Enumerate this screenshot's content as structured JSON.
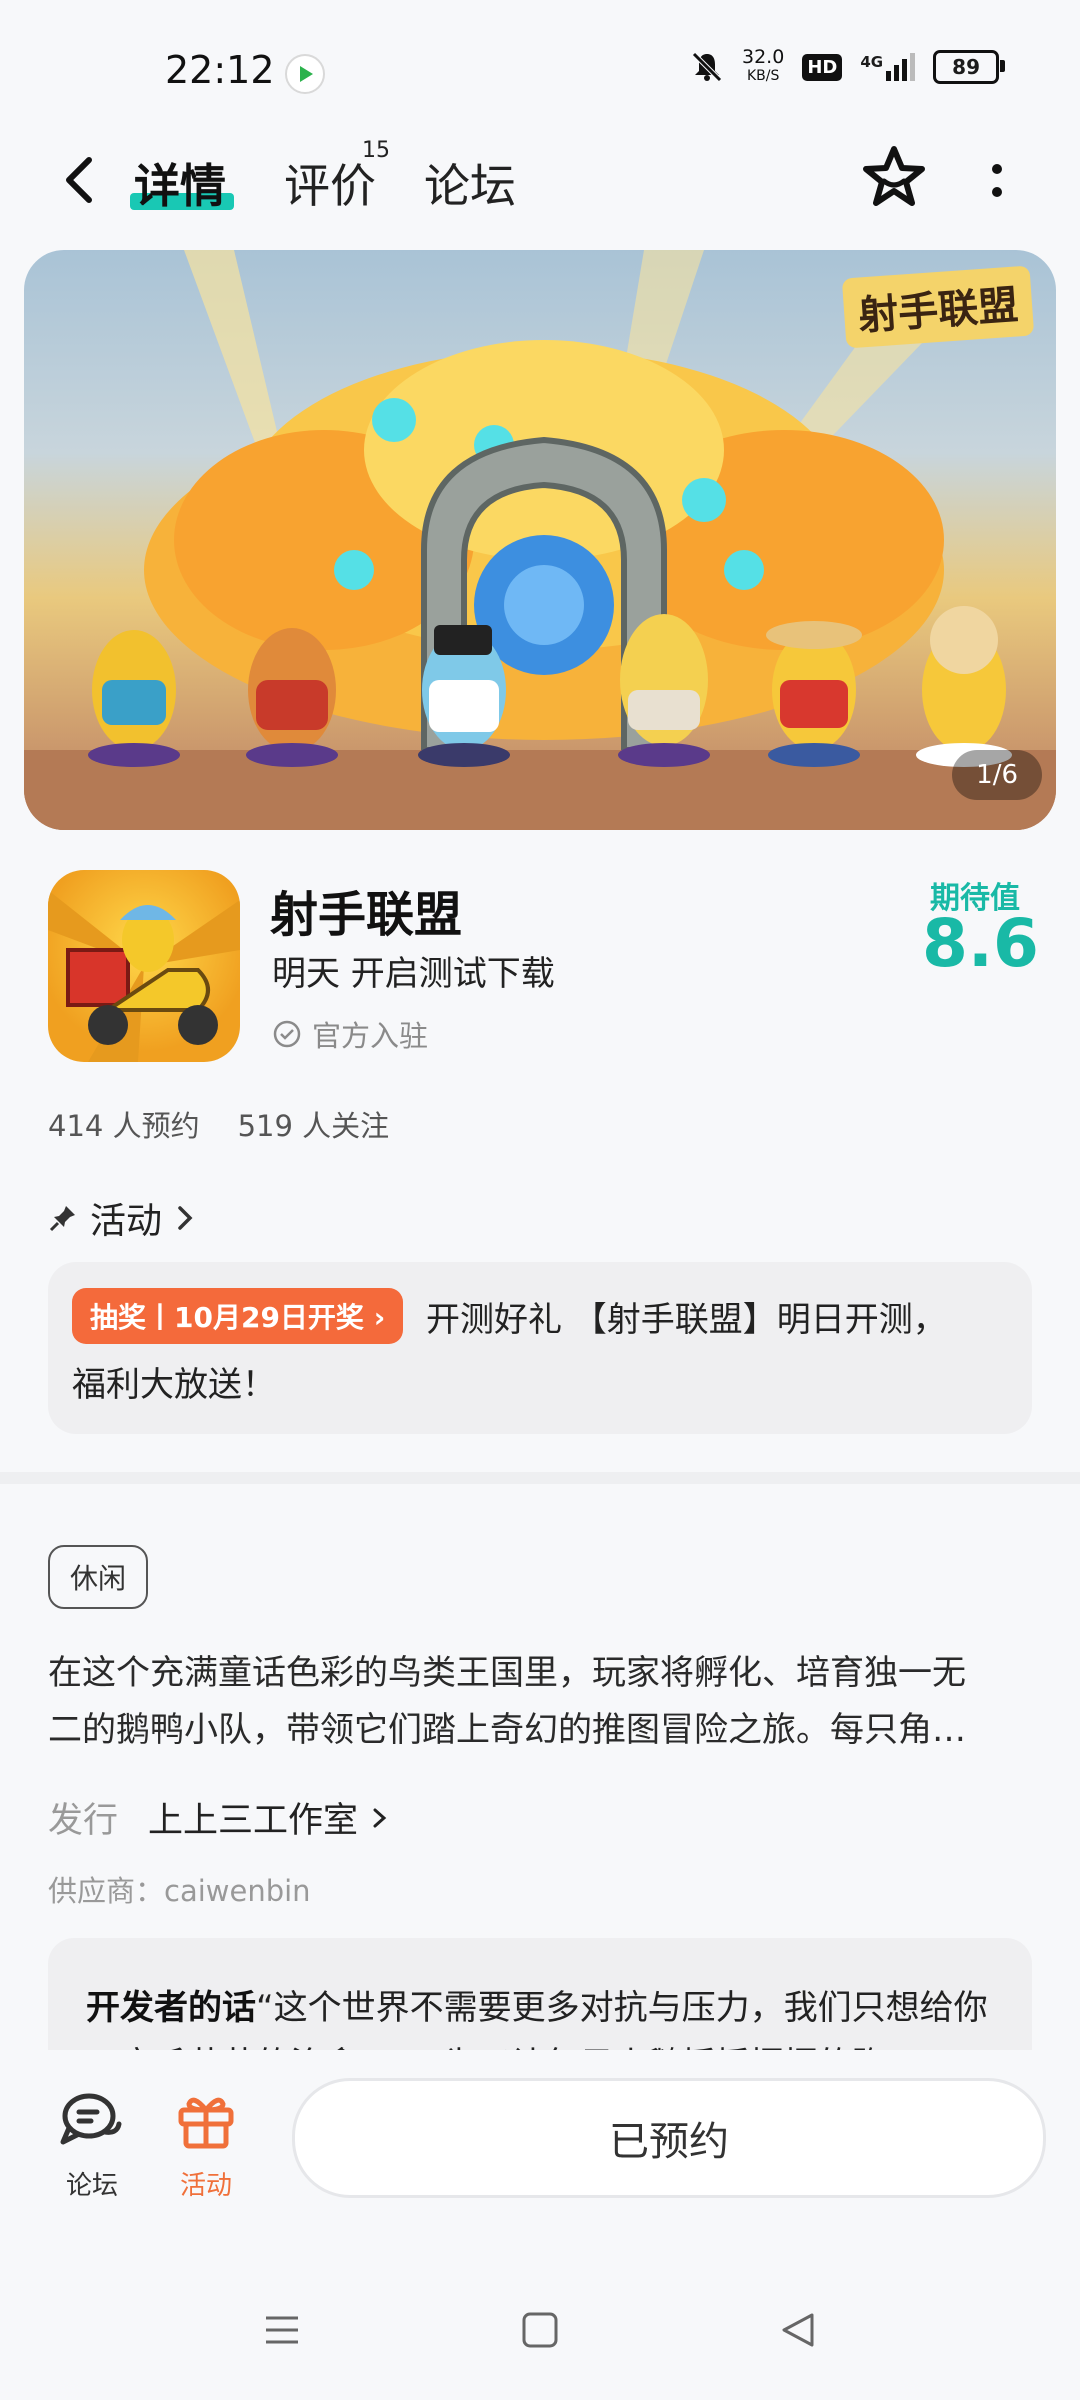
{
  "status_bar": {
    "time": "22:12",
    "net_speed_value": "32.0",
    "net_speed_unit": "KB/S",
    "hd": "HD",
    "signal": "4G",
    "battery": "89"
  },
  "top_nav": {
    "tabs": [
      {
        "label": "详情"
      },
      {
        "label": "评价"
      },
      {
        "label": "论坛"
      }
    ],
    "review_count": "15"
  },
  "banner": {
    "counter": "1/6",
    "logo_text": "射手联盟"
  },
  "app": {
    "name": "射手联盟",
    "subtitle": "明天 开启测试下载",
    "official": "官方入驻",
    "expect_label": "期待值",
    "expect_score": "8.6",
    "reservations": "414 人预约",
    "followers": "519 人关注"
  },
  "activity": {
    "heading": "活动",
    "badge": "抽奖丨10月29日开奖",
    "text_line1": "开测好礼 【射手联盟】明日开测，",
    "text_line2": "福利大放送！"
  },
  "detail": {
    "tag": "休闲",
    "description_line1": "在这个充满童话色彩的鸟类王国里，玩家将孵化、培育独一无",
    "description_line2": "二的鹅鸭小队，带领它们踏上奇幻的推图冒险之旅。每只角…",
    "publisher_label": "发行",
    "publisher_value": "上上三工作室",
    "supplier": "供应商：caiwenbin",
    "dev_words_label": "开发者的话",
    "dev_words_text": "“这个世界不需要更多对抗与压力，我们只想给你一窝毛茸茸的治愈……”为了让每只小鹅摇摇摆摆的跑"
  },
  "bottom_bar": {
    "forum_label": "论坛",
    "activity_label": "活动",
    "reserve_button": "已预约"
  },
  "colors": {
    "accent": "#19c8b4",
    "score": "#19b9a6",
    "badge": "#f46a3b",
    "activity_icon": "#f0703a"
  }
}
